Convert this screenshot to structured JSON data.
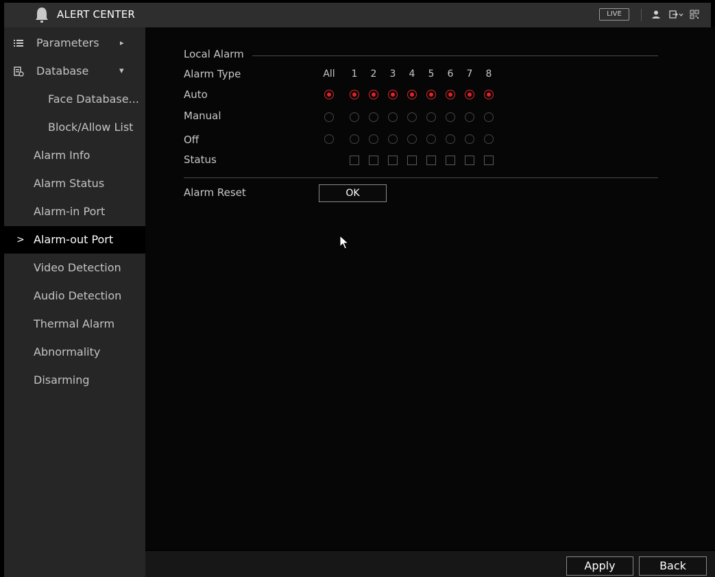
{
  "app": {
    "title": "ALERT CENTER",
    "live_label": "LIVE"
  },
  "icons": {
    "bell": "bell-icon",
    "user": "user-icon",
    "logout": "logout-icon",
    "qr": "qr-code-icon"
  },
  "colors": {
    "accent_red": "#e0262a",
    "active_nav_bg": "#000000"
  },
  "sidebar": {
    "items": [
      {
        "label": "Parameters",
        "icon": "list-icon",
        "suffix": "▸"
      },
      {
        "label": "Database",
        "icon": "database-icon",
        "suffix": "▾"
      },
      {
        "label": "Face Database..."
      },
      {
        "label": "Block/Allow List"
      },
      {
        "label": "Alarm Info"
      },
      {
        "label": "Alarm Status"
      },
      {
        "label": "Alarm-in Port"
      },
      {
        "label": "Alarm-out Port",
        "active": true,
        "prefix": ">"
      },
      {
        "label": "Video Detection"
      },
      {
        "label": "Audio Detection"
      },
      {
        "label": "Thermal Alarm"
      },
      {
        "label": "Abnormality"
      },
      {
        "label": "Disarming"
      }
    ]
  },
  "main": {
    "section_title": "Local Alarm",
    "labels": {
      "alarm_type": "Alarm Type",
      "auto": "Auto",
      "manual": "Manual",
      "off": "Off",
      "status": "Status",
      "alarm_reset": "Alarm Reset"
    },
    "columns": [
      "All",
      "1",
      "2",
      "3",
      "4",
      "5",
      "6",
      "7",
      "8"
    ],
    "selected_mode": "Auto",
    "ok_label": "OK"
  },
  "footer": {
    "apply_label": "Apply",
    "back_label": "Back"
  }
}
